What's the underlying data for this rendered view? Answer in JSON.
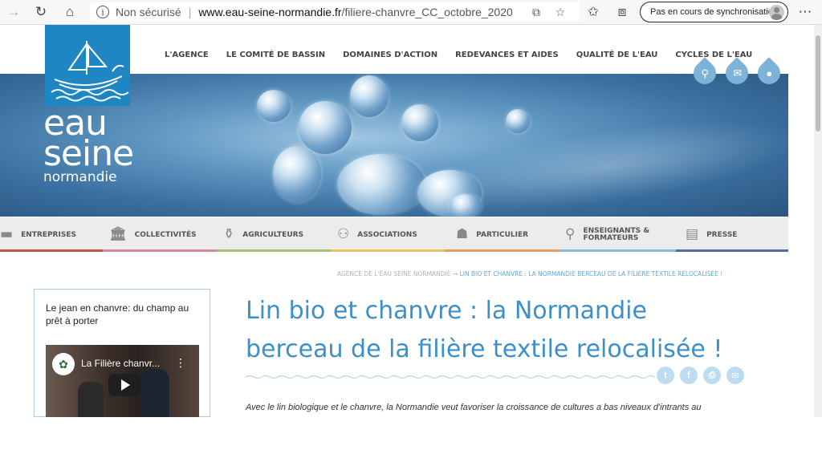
{
  "browser": {
    "insecure_label": "Non sécurisé",
    "url_domain": "www.eau-seine-normandie.fr",
    "url_path": "/filiere-chanvre_CC_octobre_2020",
    "sync_label": "Pas en cours de synchronisation",
    "icons": [
      "back-icon",
      "refresh-icon",
      "home-icon",
      "info-icon",
      "reader-icon",
      "star-icon",
      "favorites-icon",
      "collections-icon",
      "menu-icon"
    ]
  },
  "logo": {
    "line1": "eau",
    "line2": "seine",
    "line3": "normandie",
    "brand_color": "#1e87c3"
  },
  "topnav": [
    "L'AGENCE",
    "LE COMITÉ DE BASSIN",
    "DOMAINES D'ACTION",
    "REDEVANCES ET AIDES",
    "QUALITÉ DE L'EAU",
    "CYCLES DE L'EAU"
  ],
  "header_icons": [
    "search-icon",
    "mail-icon",
    "user-icon"
  ],
  "audiences": [
    {
      "label": "ENTREPRISES",
      "icon": "briefcase-icon",
      "color": "#c9534f"
    },
    {
      "label": "COLLECTIVITÉS",
      "icon": "building-icon",
      "color": "#d08a9c"
    },
    {
      "label": "AGRICULTEURS",
      "icon": "bottles-icon",
      "color": "#a7bf76"
    },
    {
      "label": "ASSOCIATIONS",
      "icon": "people-icon",
      "color": "#e2c566"
    },
    {
      "label": "PARTICULIER",
      "icon": "person-icon",
      "color": "#e29f60"
    },
    {
      "label": "ENSEIGNANTS &",
      "label2": "FORMATEURS",
      "icon": "teacher-icon",
      "color": "#8fb8d3"
    },
    {
      "label": "PRESSE",
      "icon": "newspaper-icon",
      "color": "#4f6f9a"
    }
  ],
  "breadcrumb": {
    "home": "AGENCE DE L'EAU SEINE NORMANDIE",
    "arrow": "→",
    "current": "LIN BIO ET CHANVRE : LA NORMANDIE BERCEAU DE LA FILIÈRE TEXTILE RELOCALISÉE !"
  },
  "sidebar": {
    "title": "Le jean en chanvre:  du champ au prêt à porter",
    "video_title": "La Filière chanvr...",
    "video_menu": "⋮"
  },
  "article": {
    "title_line1": "Lin bio et chanvre : la Normandie",
    "title_line2": "berceau de la filière textile relocalisée !",
    "intro": "Avec le lin biologique et le chanvre, la Normandie veut favoriser la croissance de cultures a bas niveaux d'intrants au",
    "share_icons": [
      "twitter-icon",
      "facebook-icon",
      "print-icon",
      "email-icon"
    ]
  }
}
